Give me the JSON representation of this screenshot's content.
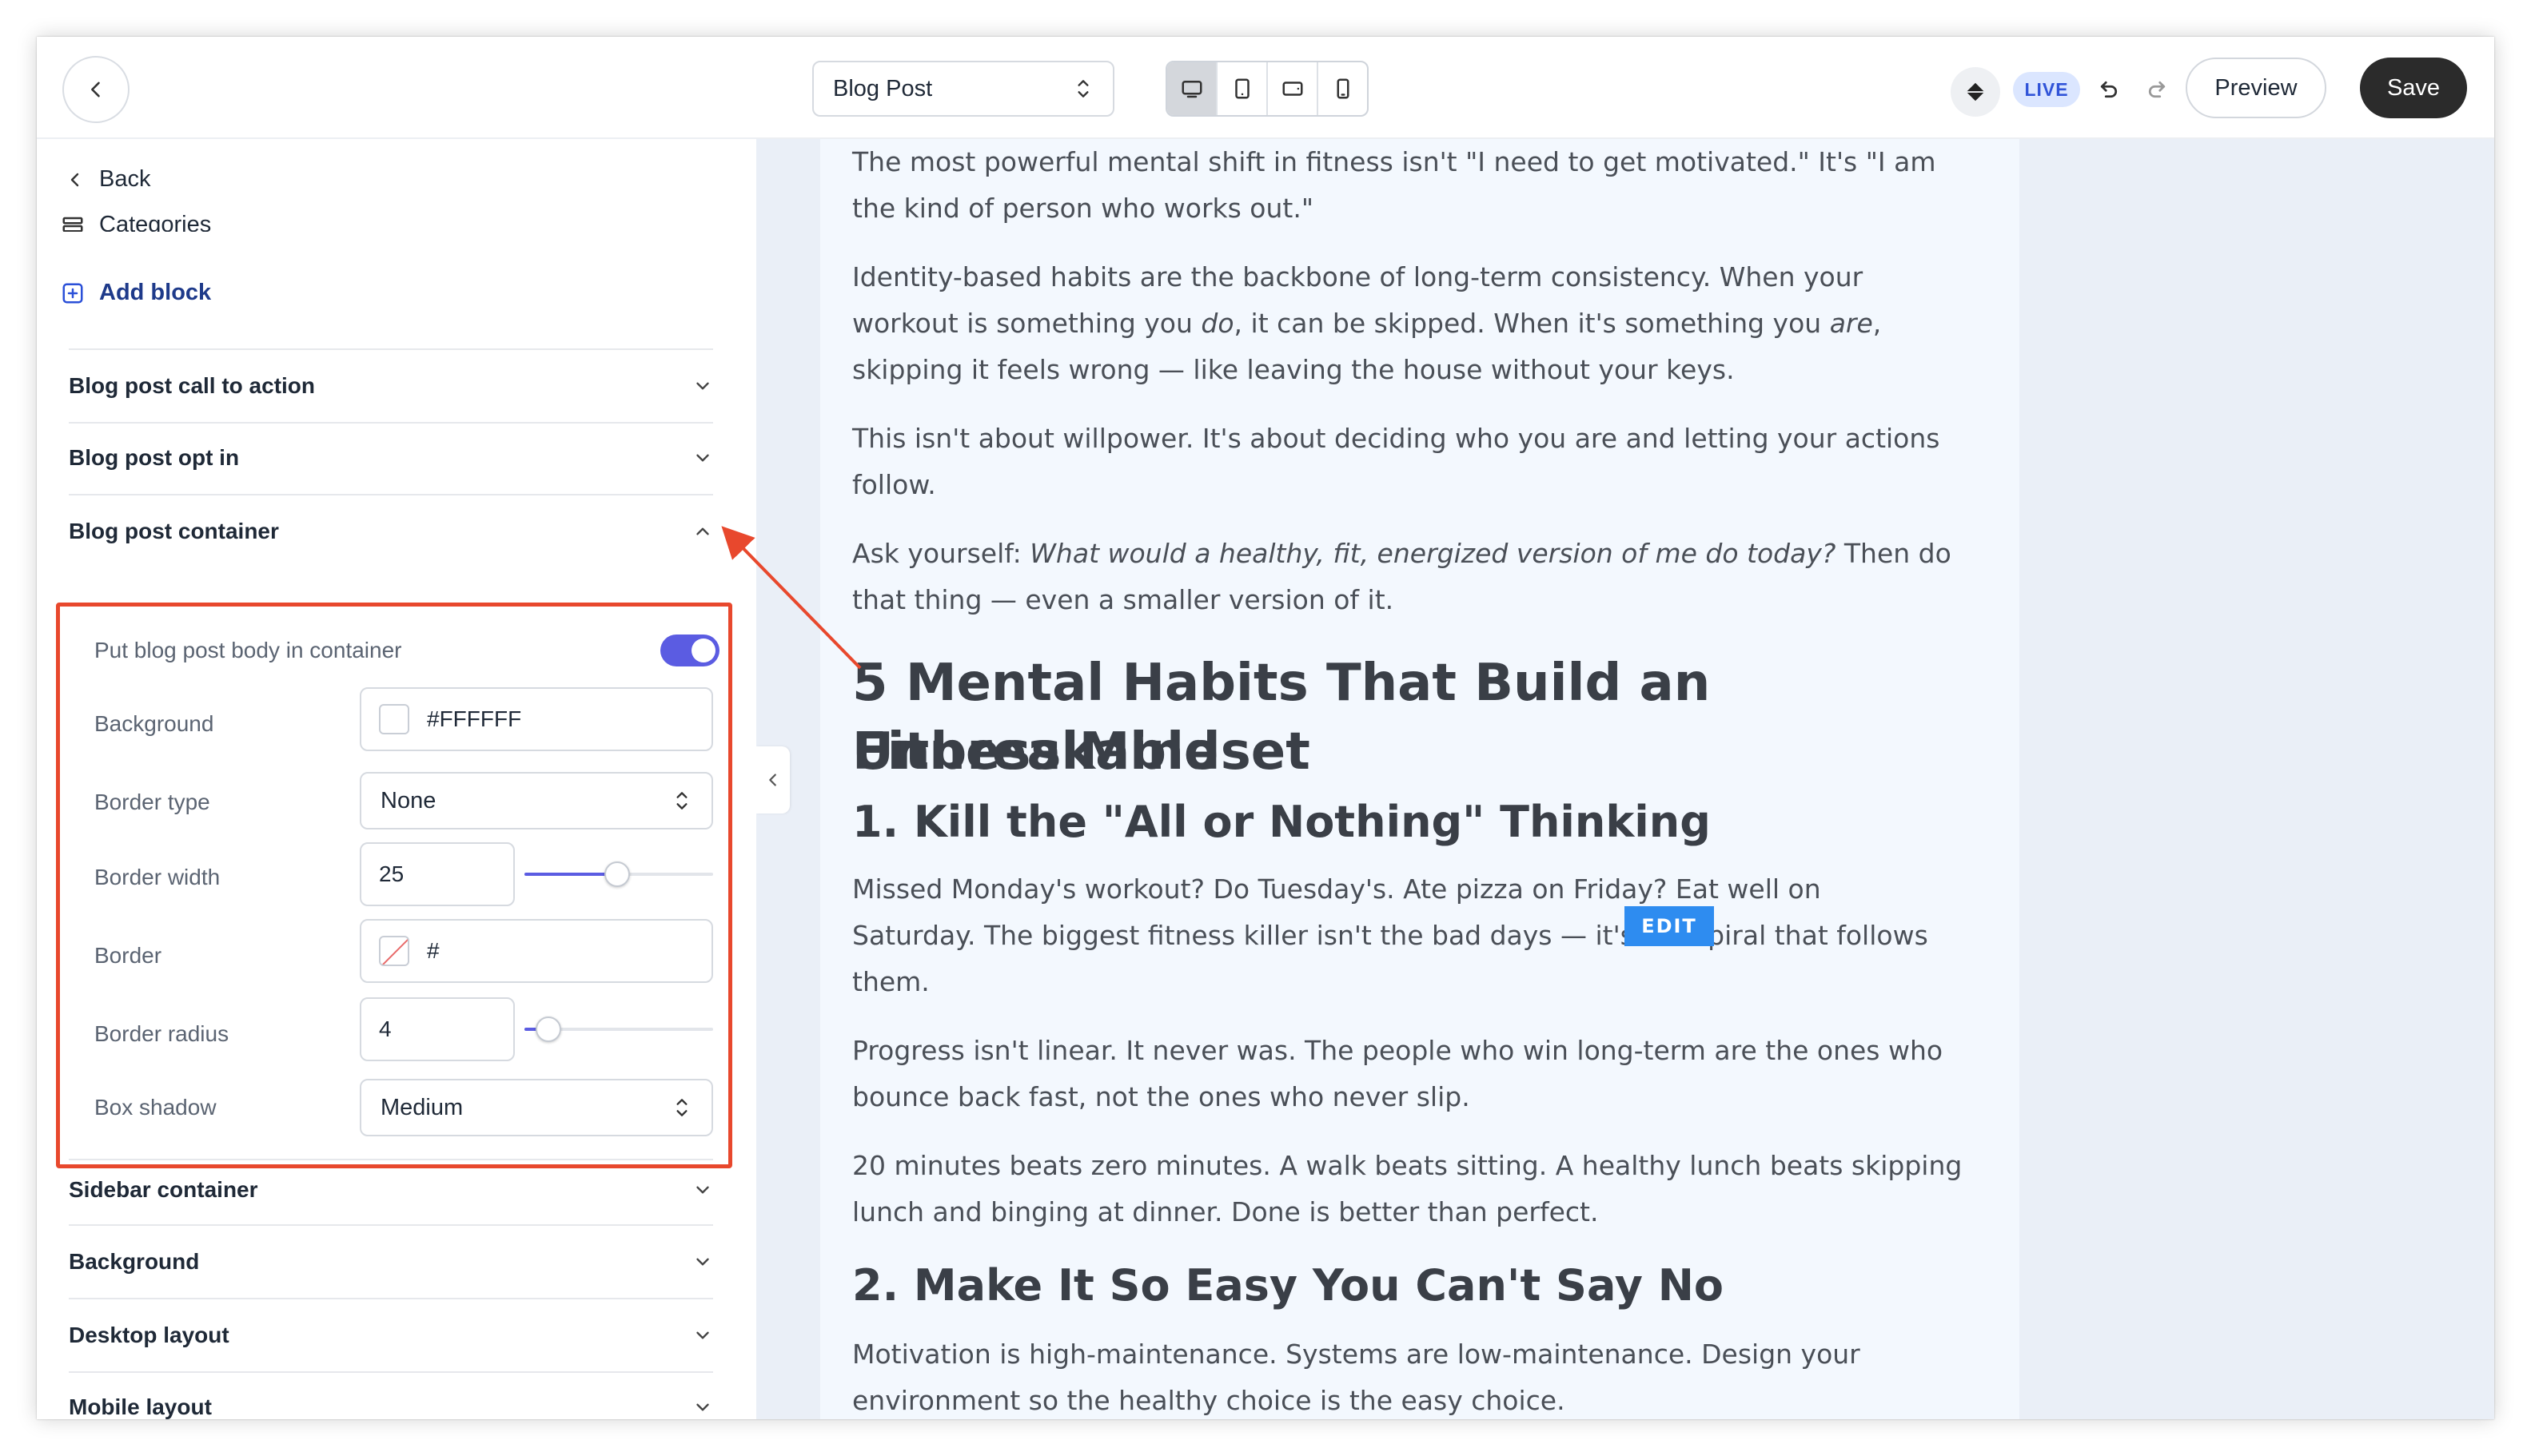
{
  "topbar": {
    "page_select": "Blog Post",
    "live_badge": "LIVE",
    "preview_label": "Preview",
    "save_label": "Save"
  },
  "sidebar": {
    "back_label": "Back",
    "categories_label": "Categories",
    "add_block_label": "Add block",
    "sections": {
      "call_to_action": "Blog post call to action",
      "opt_in": "Blog post opt in",
      "container": "Blog post container",
      "sidebar_container": "Sidebar container",
      "background": "Background",
      "desktop_layout": "Desktop layout",
      "mobile_layout": "Mobile layout"
    },
    "container_panel": {
      "toggle_label": "Put blog post body in container",
      "toggle_on": true,
      "background_label": "Background",
      "background_value": "#FFFFFF",
      "border_type_label": "Border type",
      "border_type_value": "None",
      "border_width_label": "Border width",
      "border_width_value": "25",
      "border_label": "Border",
      "border_value": "#",
      "border_radius_label": "Border radius",
      "border_radius_value": "4",
      "box_shadow_label": "Box shadow",
      "box_shadow_value": "Medium"
    }
  },
  "article": {
    "p1a": "The most powerful mental shift in fitness isn't \"I need to get motivated.\" It's \"I am",
    "p1b": "the kind of person who works out.\"",
    "p2a": "Identity-based habits are the backbone of long-term consistency. When your",
    "p2b_1": "workout is something you ",
    "p2b_em": "do",
    "p2b_2": ", it can be skipped. When it's something you ",
    "p2b_em2": "are",
    "p2b_3": ",",
    "p2c": "skipping it feels wrong — like leaving the house without your keys.",
    "p3a": "This isn't about willpower. It's about deciding who you are and letting your actions",
    "p3b": "follow.",
    "p4a_1": "Ask yourself: ",
    "p4a_em": "What would a healthy, fit, energized version of me do today?",
    "p4a_2": " Then do",
    "p4b": "that thing — even a smaller version of it.",
    "h2a": "5 Mental Habits That Build an Unbreakable",
    "h2b": "Fitness Mindset",
    "h3_1": "1. Kill the \"All or Nothing\" Thinking",
    "p5a": "Missed Monday's workout? Do Tuesday's. Ate pizza on Friday? Eat well on",
    "p5b": "Saturday. The biggest fitness killer isn't the bad days — it's the spiral that follows",
    "p5c": "them.",
    "edit_tag": "EDIT",
    "p6a": "Progress isn't linear. It never was. The people who win long-term are the ones who",
    "p6b": "bounce back fast, not the ones who never slip.",
    "p7a": "20 minutes beats zero minutes. A walk beats sitting. A healthy lunch beats skipping",
    "p7b": "lunch and binging at dinner. Done is better than perfect.",
    "h3_2": "2. Make It So Easy You Can't Say No",
    "p8a": "Motivation is high-maintenance. Systems are low-maintenance. Design your",
    "p8b": "environment so the healthy choice is the easy choice."
  },
  "colors": {
    "accent": "#5b5ce2",
    "highlight": "#e8482d",
    "live_bg": "#dbe6ff",
    "edit_tag": "#2e8cf0"
  },
  "icons": {
    "back": "chevron-left-icon",
    "select": "chevron-up-down-icon",
    "devices": [
      "desktop-icon",
      "tablet-portrait-icon",
      "tablet-landscape-icon",
      "mobile-icon"
    ],
    "diamond": "diamond-icon",
    "undo": "undo-icon",
    "redo": "redo-icon",
    "expand": "chevron-down-icon",
    "collapse": "chevron-up-icon"
  }
}
